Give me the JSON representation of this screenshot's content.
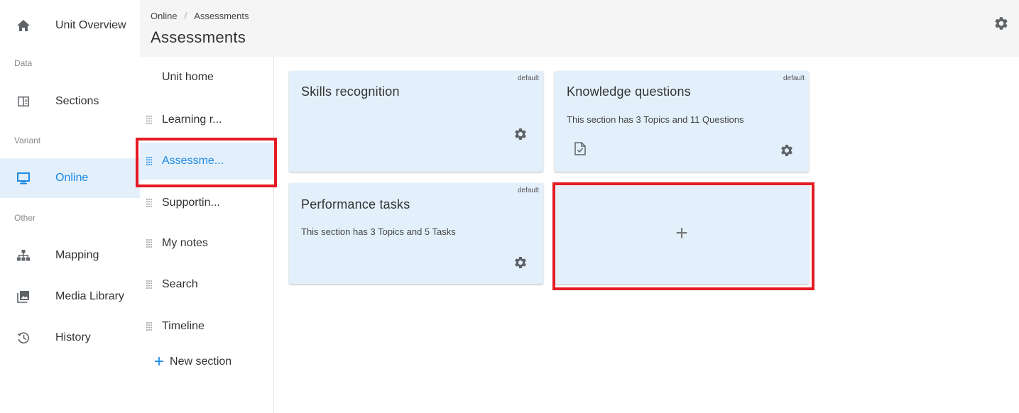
{
  "nav": {
    "unit_overview": "Unit Overview",
    "group_data": "Data",
    "sections": "Sections",
    "group_variant": "Variant",
    "online": "Online",
    "group_other": "Other",
    "mapping": "Mapping",
    "media_library": "Media Library",
    "history": "History"
  },
  "header": {
    "breadcrumb": [
      "Online",
      "Assessments"
    ],
    "separator": "/",
    "title": "Assessments"
  },
  "section_list": {
    "items": [
      {
        "label": "Unit home"
      },
      {
        "label": "Learning r..."
      },
      {
        "label": "Assessme..."
      },
      {
        "label": "Supportin..."
      },
      {
        "label": "My notes"
      },
      {
        "label": "Search"
      },
      {
        "label": "Timeline"
      }
    ],
    "active_index": 2,
    "new_section_label": "New section",
    "new_section_icon": "+"
  },
  "cards": [
    {
      "title": "Skills recognition",
      "badge": "default",
      "description": ""
    },
    {
      "title": "Knowledge questions",
      "badge": "default",
      "description": "This section has 3 Topics and 11 Questions",
      "icon": "document-check-icon"
    },
    {
      "title": "Performance tasks",
      "badge": "default",
      "description": "This section has 3 Topics and 5 Tasks"
    }
  ],
  "add_card": {
    "icon": "+"
  },
  "colors": {
    "accent": "#1e88e5",
    "active_bg": "#e3f0fb",
    "card_bg": "#e3f0fb",
    "highlight": "#e41b23",
    "icon_gray": "#5f6368"
  }
}
